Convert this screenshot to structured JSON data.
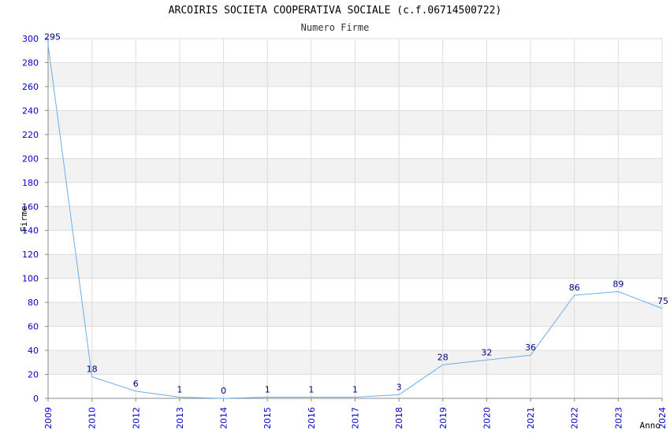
{
  "chart_data": {
    "type": "line",
    "title": "ARCOIRIS SOCIETA COOPERATIVA SOCIALE (c.f.06714500722)",
    "subtitle": "Numero Firme",
    "xlabel": "Anno",
    "ylabel": "Firme",
    "x": [
      "2009",
      "2010",
      "2012",
      "2013",
      "2014",
      "2015",
      "2016",
      "2017",
      "2018",
      "2019",
      "2020",
      "2021",
      "2022",
      "2023",
      "2024"
    ],
    "values": [
      295,
      18,
      6,
      1,
      0,
      1,
      1,
      1,
      3,
      28,
      32,
      36,
      86,
      89,
      75
    ],
    "ylim": [
      0,
      300
    ],
    "yticks": [
      0,
      20,
      40,
      60,
      80,
      100,
      120,
      140,
      160,
      180,
      200,
      220,
      240,
      260,
      280,
      300
    ],
    "grid": true,
    "colors": {
      "line": "#6aaef0",
      "tick_label": "#0000cc",
      "data_label": "#000080",
      "band": "#f2f2f2",
      "gridline": "#dddddd"
    }
  }
}
